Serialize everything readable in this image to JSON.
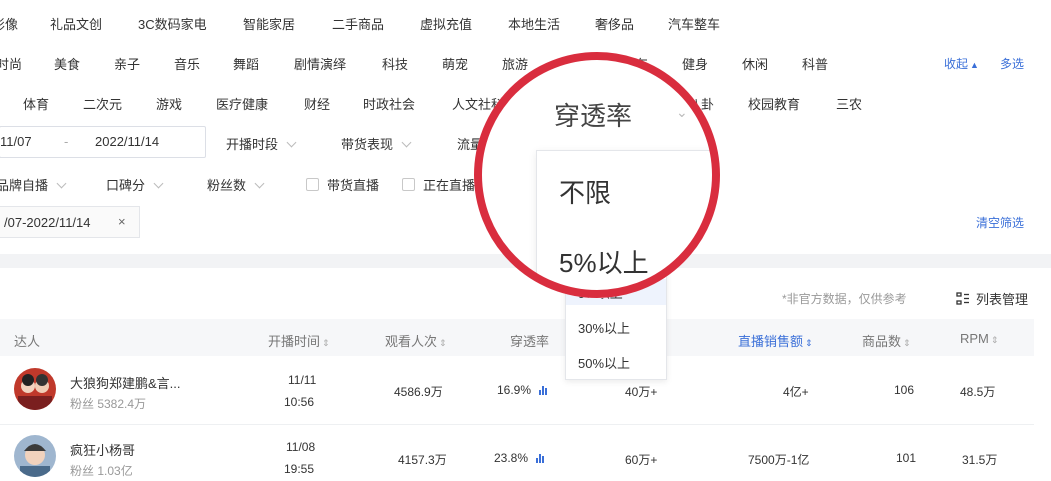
{
  "category_row1": [
    "影像",
    "礼品文创",
    "3C数码家电",
    "智能家居",
    "二手商品",
    "虚拟充值",
    "本地生活",
    "奢侈品",
    "汽车整车"
  ],
  "category_row2": [
    "时尚",
    "美食",
    "亲子",
    "音乐",
    "舞蹈",
    "剧情演绎",
    "科技",
    "萌宠",
    "旅游",
    "汽车",
    "健身",
    "休闲",
    "科普"
  ],
  "category_row3": [
    "体育",
    "二次元",
    "游戏",
    "医疗健康",
    "财经",
    "时政社会",
    "人文社科",
    "八卦",
    "校园教育",
    "三农"
  ],
  "collapse_label": "收起",
  "multi_select_label": "多选",
  "date_range": {
    "start": "11/07",
    "separator": "-",
    "end": "2022/11/14"
  },
  "filter_row1": [
    "开播时段",
    "带货表现",
    "流量"
  ],
  "filter_row2": [
    "品牌自播",
    "口碑分",
    "粉丝数"
  ],
  "checkboxes": [
    "带货直播",
    "正在直播"
  ],
  "active_filter_chip": "/07-2022/11/14",
  "chip_close": "×",
  "clear_filters": "清空筛选",
  "disclaimer": "*非官方数据，仅供参考",
  "column_manage": "列表管理",
  "table_headers": {
    "creator": "达人",
    "start_time": "开播时间",
    "viewers": "观看人次",
    "penetration": "穿透率",
    "live_sales": "直播销售额",
    "products": "商品数",
    "rpm": "RPM"
  },
  "rows": [
    {
      "name": "大狼狗郑建鹏&言...",
      "fans": "粉丝 5382.4万",
      "date": "11/11",
      "time": "10:56",
      "viewers": "4586.9万",
      "penetration": "16.9%",
      "mid": "40万+",
      "sales": "4亿+",
      "products": "106",
      "rpm": "48.5万"
    },
    {
      "name": "疯狂小杨哥",
      "fans": "粉丝 1.03亿",
      "date": "11/08",
      "time": "19:55",
      "viewers": "4157.3万",
      "penetration": "23.8%",
      "mid": "60万+",
      "sales": "7500万-1亿",
      "products": "101",
      "rpm": "31.5万"
    }
  ],
  "dropdown_options": [
    "5%以上",
    "30%以上",
    "50%以上"
  ],
  "magnified": {
    "header": "穿透率",
    "opt1": "不限",
    "opt2": "5%以上"
  },
  "colors": {
    "link": "#3a6fd8",
    "ring": "#d92d3e",
    "header_bg": "#f6f7f9"
  }
}
